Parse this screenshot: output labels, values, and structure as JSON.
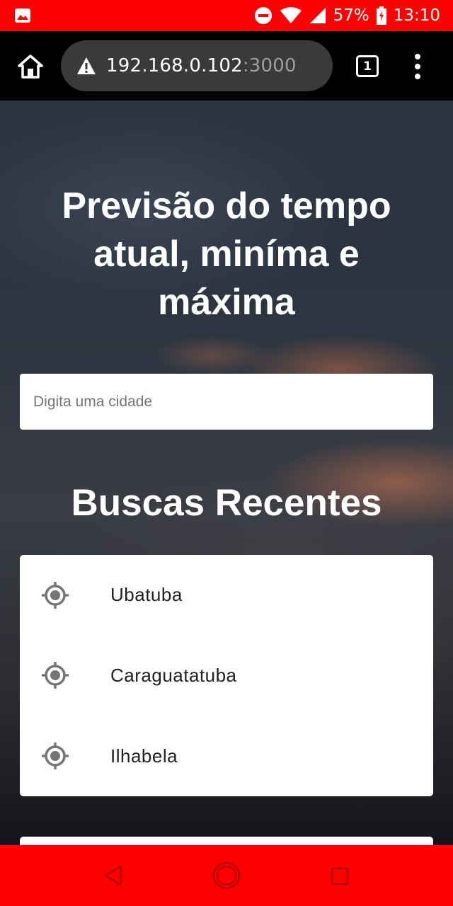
{
  "status_bar": {
    "battery": "57%",
    "time": "13:10",
    "icons": [
      "image-notification-icon",
      "do-not-disturb-icon",
      "wifi-icon",
      "signal-icon",
      "battery-charging-icon"
    ]
  },
  "browser": {
    "url_host": "192.168.0.102",
    "url_port": ":3000",
    "tab_count": "1",
    "icons": [
      "home-icon",
      "warning-icon",
      "more-vert-icon"
    ]
  },
  "page": {
    "headline": "Previsão do tempo atual, miníma e máxima",
    "search_placeholder": "Digita uma cidade",
    "recent_title": "Buscas Recentes",
    "recent_searches": [
      {
        "label": "Ubatuba",
        "icon": "my-location-icon"
      },
      {
        "label": "Caraguatatuba",
        "icon": "my-location-icon"
      },
      {
        "label": "Ilhabela",
        "icon": "my-location-icon"
      }
    ]
  },
  "nav_bar": {
    "icons": [
      "back-icon",
      "home-circle-icon",
      "recents-square-icon"
    ]
  },
  "colors": {
    "system_bars": "#ff0000",
    "browser_toolbar": "#000000",
    "url_field": "#3a3a3a",
    "card": "#ffffff",
    "icon_gray": "#757575"
  }
}
